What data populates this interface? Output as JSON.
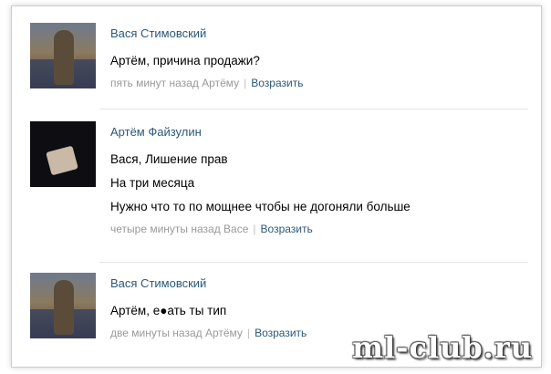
{
  "comments": [
    {
      "author": "Вася Стимовский",
      "lines": [
        "Артём, причина продажи?"
      ],
      "time": "пять минут назад Артёму",
      "reply_label": "Возразить"
    },
    {
      "author": "Артём Файзулин",
      "lines": [
        "Вася, Лишение прав",
        "На три месяца",
        "Нужно что то по мощнее чтобы не догоняли больше"
      ],
      "time": "четыре минуты назад Васе",
      "reply_label": "Возразить"
    },
    {
      "author": "Вася Стимовский",
      "lines": [
        "Артём, е●ать ты тип"
      ],
      "time": "две минуты назад Артёму",
      "reply_label": "Возразить"
    }
  ],
  "watermark": "ml-club.ru"
}
